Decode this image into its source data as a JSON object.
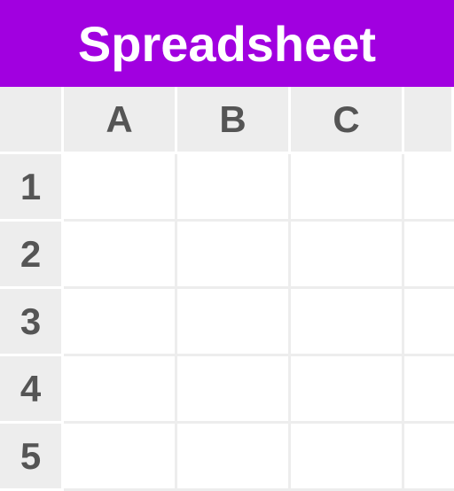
{
  "header": {
    "title": "Spreadsheet"
  },
  "columns": [
    "A",
    "B",
    "C"
  ],
  "rows": [
    "1",
    "2",
    "3",
    "4",
    "5"
  ],
  "cells": {
    "1": {
      "A": "",
      "B": "",
      "C": ""
    },
    "2": {
      "A": "",
      "B": "",
      "C": ""
    },
    "3": {
      "A": "",
      "B": "",
      "C": ""
    },
    "4": {
      "A": "",
      "B": "",
      "C": ""
    },
    "5": {
      "A": "",
      "B": "",
      "C": ""
    }
  }
}
